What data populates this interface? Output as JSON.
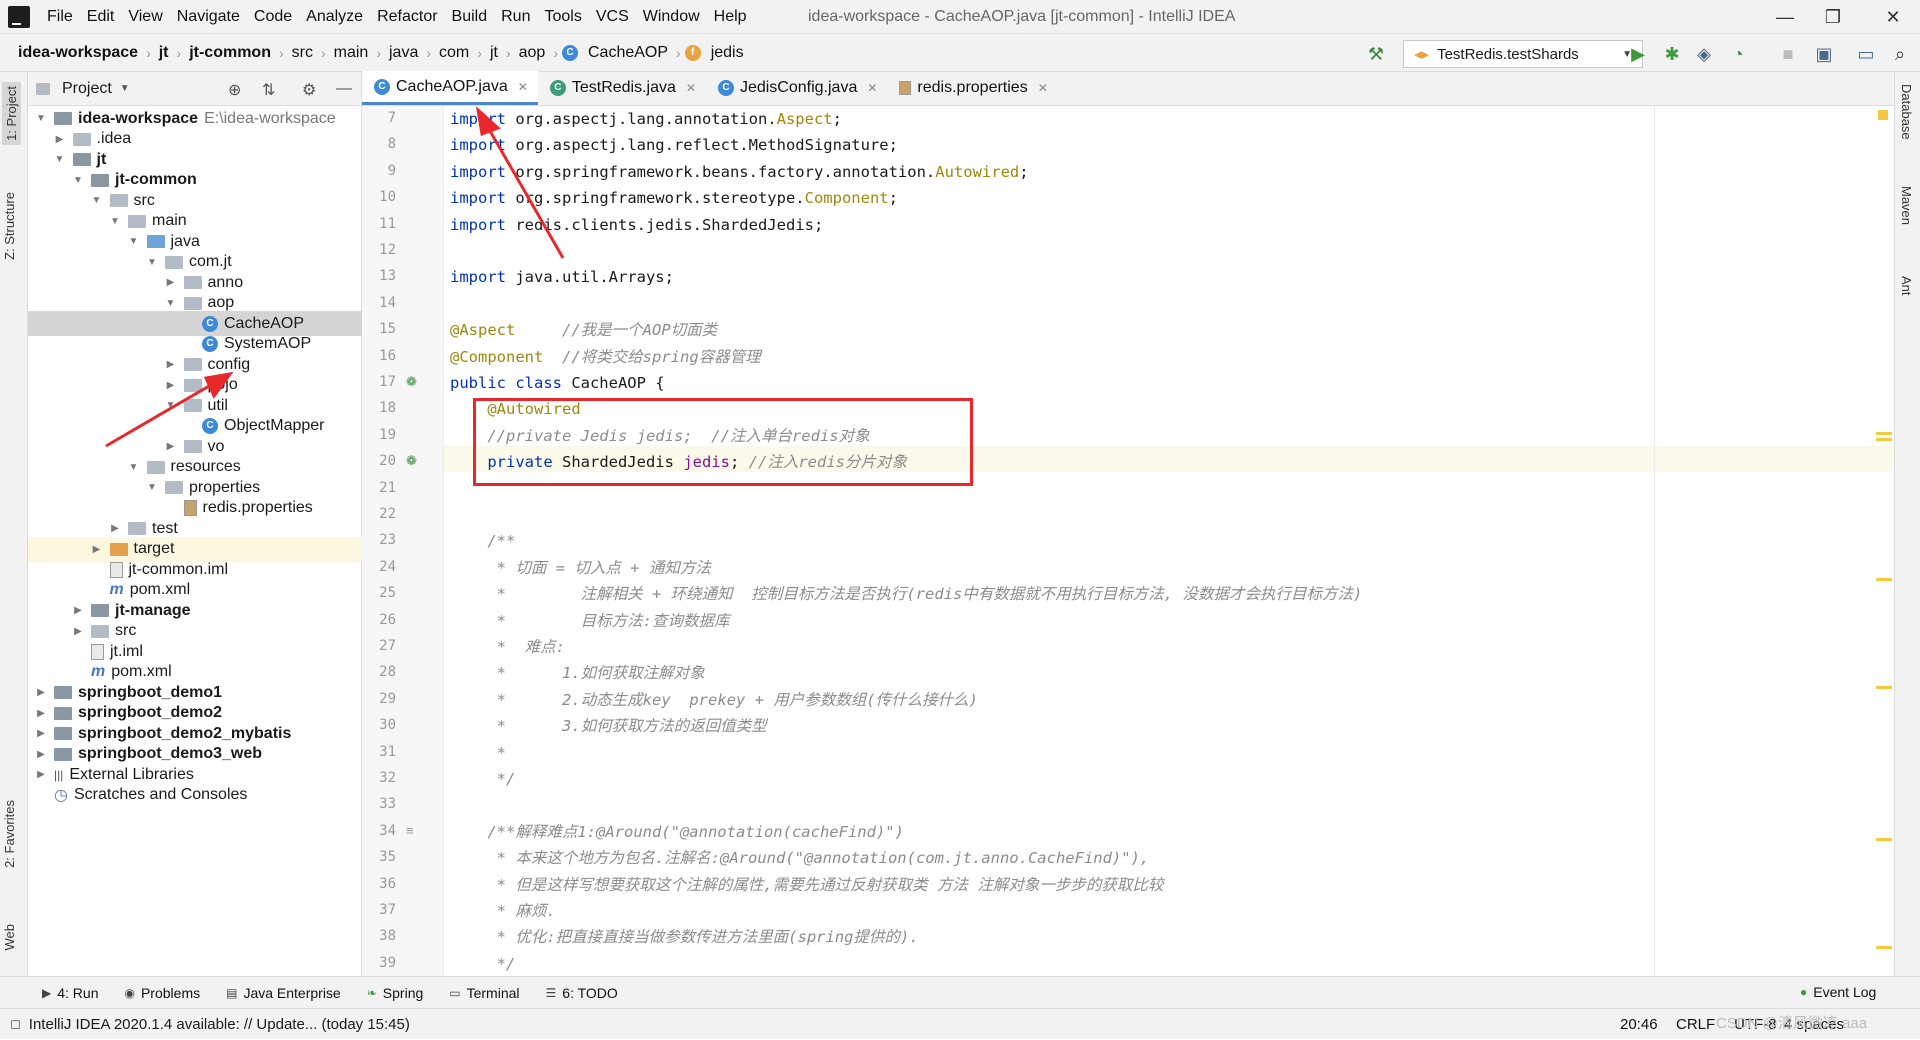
{
  "menubar": {
    "items": [
      "File",
      "Edit",
      "View",
      "Navigate",
      "Code",
      "Analyze",
      "Refactor",
      "Build",
      "Run",
      "Tools",
      "VCS",
      "Window",
      "Help"
    ],
    "window_title": "idea-workspace - CacheAOP.java [jt-common] - IntelliJ IDEA"
  },
  "breadcrumb": [
    "idea-workspace",
    "jt",
    "jt-common",
    "src",
    "main",
    "java",
    "com",
    "jt",
    "aop",
    "CacheAOP",
    "jedis"
  ],
  "run_config": "TestRedis.testShards",
  "project_panel": {
    "title": "Project",
    "tree": [
      {
        "label": "idea-workspace",
        "extra": "E:\\idea-workspace",
        "bold": true
      },
      {
        "label": ".idea"
      },
      {
        "label": "jt",
        "bold": true
      },
      {
        "label": "jt-common",
        "bold": true
      },
      {
        "label": "src"
      },
      {
        "label": "main"
      },
      {
        "label": "java"
      },
      {
        "label": "com.jt"
      },
      {
        "label": "anno"
      },
      {
        "label": "aop"
      },
      {
        "label": "CacheAOP"
      },
      {
        "label": "SystemAOP"
      },
      {
        "label": "config"
      },
      {
        "label": "pojo"
      },
      {
        "label": "util"
      },
      {
        "label": "ObjectMapper"
      },
      {
        "label": "vo"
      },
      {
        "label": "resources"
      },
      {
        "label": "properties"
      },
      {
        "label": "redis.properties"
      },
      {
        "label": "test"
      },
      {
        "label": "target"
      },
      {
        "label": "jt-common.iml"
      },
      {
        "label": "pom.xml"
      },
      {
        "label": "jt-manage",
        "bold": true
      },
      {
        "label": "src"
      },
      {
        "label": "jt.iml"
      },
      {
        "label": "pom.xml"
      },
      {
        "label": "springboot_demo1",
        "bold": true
      },
      {
        "label": "springboot_demo2",
        "bold": true
      },
      {
        "label": "springboot_demo2_mybatis",
        "bold": true
      },
      {
        "label": "springboot_demo3_web",
        "bold": true
      },
      {
        "label": "External Libraries"
      },
      {
        "label": "Scratches and Consoles"
      }
    ]
  },
  "editor_tabs": [
    "CacheAOP.java",
    "TestRedis.java",
    "JedisConfig.java",
    "redis.properties"
  ],
  "code": {
    "line_numbers": [
      "7",
      "8",
      "9",
      "10",
      "11",
      "12",
      "13",
      "14",
      "15",
      "16",
      "17",
      "18",
      "19",
      "20",
      "21",
      "22",
      "23",
      "24",
      "25",
      "26",
      "27",
      "28",
      "29",
      "30",
      "31",
      "32",
      "33",
      "34",
      "35",
      "36",
      "37",
      "38",
      "39"
    ],
    "lines": [
      {
        "kw": "import",
        "rest": " org.aspectj.lang.annotation.",
        "tail": "Aspect",
        "end": ";"
      },
      {
        "kw": "import",
        "rest": " org.aspectj.lang.reflect.MethodSignature;"
      },
      {
        "kw": "import",
        "rest": " org.springframework.beans.factory.annotation.",
        "tail": "Autowired",
        "end": ";"
      },
      {
        "kw": "import",
        "rest": " org.springframework.stereotype.",
        "tail": "Component",
        "end": ";"
      },
      {
        "kw": "import",
        "rest": " redis.clients.jedis.ShardedJedis;"
      },
      {
        "text": ""
      },
      {
        "kw": "import",
        "rest": " java.util.Arrays;"
      },
      {
        "text": ""
      },
      {
        "ann": "@Aspect",
        "cmt": "     //我是一个AOP切面类"
      },
      {
        "ann": "@Component",
        "cmt": "  //将类交给spring容器管理"
      },
      {
        "kw": "public class",
        "rest": " CacheAOP {"
      },
      {
        "indent": "    ",
        "ann": "@Autowired"
      },
      {
        "indent": "    ",
        "cmt": "//private Jedis jedis;  //注入单台redis对象"
      },
      {
        "indent": "    ",
        "kw": "private",
        "rest": " ShardedJedis ",
        "fld": "jedis",
        "end": "; ",
        "cmt": "//注入redis分片对象"
      },
      {
        "text": ""
      },
      {
        "text": ""
      },
      {
        "indent": "    ",
        "doc": "/**"
      },
      {
        "indent": "     ",
        "doc": "* 切面 = 切入点 + 通知方法"
      },
      {
        "indent": "     ",
        "doc": "*        注解相关 + 环绕通知  控制目标方法是否执行(redis中有数据就不用执行目标方法, 没数据才会执行目标方法)"
      },
      {
        "indent": "     ",
        "doc": "*        目标方法:查询数据库"
      },
      {
        "indent": "     ",
        "doc": "*  难点:"
      },
      {
        "indent": "     ",
        "doc": "*      1.如何获取注解对象"
      },
      {
        "indent": "     ",
        "doc": "*      2.动态生成key  prekey + 用户参数数组(传什么接什么)"
      },
      {
        "indent": "     ",
        "doc": "*      3.如何获取方法的返回值类型"
      },
      {
        "indent": "     ",
        "doc": "*"
      },
      {
        "indent": "     ",
        "doc": "*/"
      },
      {
        "text": ""
      },
      {
        "indent": "    ",
        "doc": "/**解释难点1:@Around(\"@annotation(cacheFind)\")"
      },
      {
        "indent": "     ",
        "doc": "* 本来这个地方为包名.注解名:@Around(\"@annotation(com.jt.anno.CacheFind)\"),"
      },
      {
        "indent": "     ",
        "doc": "* 但是这样写想要获取这个注解的属性,需要先通过反射获取类 方法 注解对象一步步的获取比较"
      },
      {
        "indent": "     ",
        "doc": "* 麻烦."
      },
      {
        "indent": "     ",
        "doc": "* 优化:把直接直接当做参数传进方法里面(spring提供的)."
      },
      {
        "indent": "     ",
        "doc": "*/"
      }
    ]
  },
  "right_stripe": [
    "Database",
    "Maven",
    "Ant"
  ],
  "left_stripe": [
    "1: Project",
    "Z: Structure",
    "2: Favorites",
    "Web"
  ],
  "bottom_tabs": [
    "4: Run",
    "Problems",
    "Java Enterprise",
    "Spring",
    "Terminal",
    "6: TODO",
    "Event Log"
  ],
  "status": {
    "message": "IntelliJ IDEA 2020.1.4 available: // Update... (today 15:45)",
    "position": "20:46",
    "line_sep": "CRLF",
    "encoding": "UTF-8",
    "indent": "4 spaces",
    "watermark": "CSDN @清风微凉 aaa"
  },
  "colors": {
    "highlight_box": "#e8282b",
    "arrow": "#e8282b",
    "selection": "#d5d5d5",
    "tab_underline": "#4a88c7"
  }
}
